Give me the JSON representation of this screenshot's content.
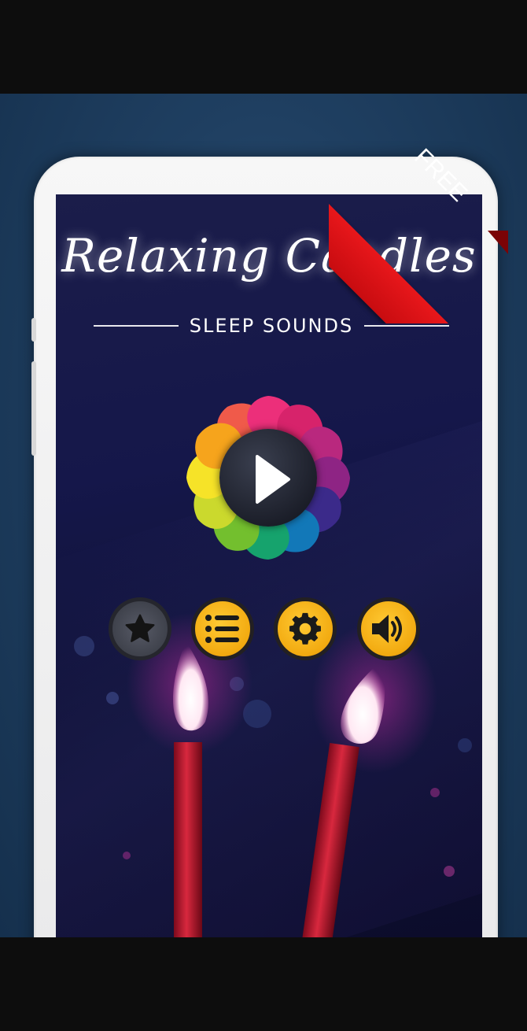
{
  "app": {
    "title": "Relaxing Candles",
    "subtitle": "SLEEP SOUNDS",
    "badge": "FREE"
  },
  "controls": {
    "play": {
      "icon": "play-icon"
    },
    "buttons": [
      {
        "name": "favorites",
        "icon": "star-icon"
      },
      {
        "name": "playlist",
        "icon": "list-icon"
      },
      {
        "name": "settings",
        "icon": "gear-icon"
      },
      {
        "name": "sound",
        "icon": "speaker-icon"
      }
    ]
  },
  "colors": {
    "badge_red": "#e8171b",
    "button_gold": "#f2aa10",
    "button_gray": "#4a4c56",
    "wheel": [
      "#f05a4a",
      "#ec2f7a",
      "#d7236b",
      "#b9287e",
      "#8e2484",
      "#3b2a8a",
      "#1278b8",
      "#16a36d",
      "#73bf2e",
      "#cbd92d",
      "#f6e328",
      "#f6a41c"
    ]
  }
}
